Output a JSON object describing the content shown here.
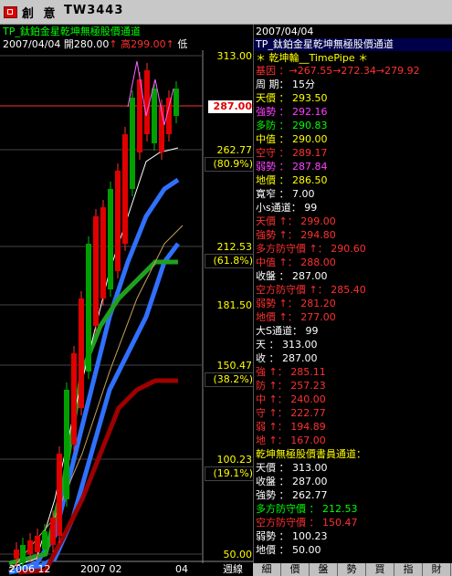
{
  "titlebar": {
    "title": "創  意",
    "code": "TW3443"
  },
  "chart_header": {
    "title": "TP_鈦鉑金星乾坤無極股價通道",
    "date": "2007/04/04",
    "open": "開280.00",
    "high": "高299.00",
    "last": "低"
  },
  "price_axis": [
    {
      "label": "313.00",
      "pct": ""
    },
    {
      "label": "287.00",
      "pct": "",
      "highlight": true
    },
    {
      "label": "262.77",
      "pct": "(80.9%)"
    },
    {
      "label": "212.53",
      "pct": "(61.8%)"
    },
    {
      "label": "181.50",
      "pct": ""
    },
    {
      "label": "150.47",
      "pct": "(38.2%)"
    },
    {
      "label": "100.23",
      "pct": "(19.1%)"
    },
    {
      "label": "50.00",
      "pct": ""
    }
  ],
  "time_axis": [
    "2006 12",
    "2007 02",
    "04",
    "週線"
  ],
  "panel": {
    "date": "2007/04/04",
    "title": "TP_鈦鉑金星乾坤無極股價通道",
    "rows": [
      {
        "text": "基因 ：→267.55→272.34→279.92",
        "color": "#ff3030"
      },
      {
        "text": "周   期：  15分",
        "color": "#ffffff"
      },
      {
        "text": "天價  ：  293.50",
        "color": "#ffff00"
      },
      {
        "text": "強勢  ：  292.16",
        "color": "#ff40ff"
      },
      {
        "text": "多防  ：  290.83",
        "color": "#00ff00"
      },
      {
        "text": "中值  ：  290.00",
        "color": "#ffff00"
      },
      {
        "text": "空守  ：  289.17",
        "color": "#ff3030"
      },
      {
        "text": "弱勢  ：  287.84",
        "color": "#ff40ff"
      },
      {
        "text": "地價  ：  286.50",
        "color": "#ffff00"
      },
      {
        "text": "寬窄  ：   7.00",
        "color": "#ffffff"
      },
      {
        "text": "小s通道：  99",
        "color": "#ffffff"
      },
      {
        "text": "天價  ↑：  299.00",
        "color": "#ff3030"
      },
      {
        "text": "強勢  ↑：  294.80",
        "color": "#ff3030"
      },
      {
        "text": "多方防守價 ↑： 290.60",
        "color": "#ff3030"
      },
      {
        "text": "中值  ↑：  288.00",
        "color": "#ff3030"
      },
      {
        "text": "收盤  ：  287.00",
        "color": "#ffffff"
      },
      {
        "text": "空方防守價 ↑：  285.40",
        "color": "#ff3030"
      },
      {
        "text": "弱勢  ↑：  281.20",
        "color": "#ff3030"
      },
      {
        "text": "地價  ↑：  277.00",
        "color": "#ff3030"
      },
      {
        "text": "大S通道：  99",
        "color": "#ffffff"
      },
      {
        "text": "天   ：  313.00",
        "color": "#ffffff"
      },
      {
        "text": "  收  ：  287.00",
        "color": "#ffffff"
      },
      {
        "text": "強  ↑：  285.11",
        "color": "#ff3030"
      },
      {
        "text": "防  ↑：  257.23",
        "color": "#ff3030"
      },
      {
        "text": "中  ↑：  240.00",
        "color": "#ff3030"
      },
      {
        "text": "守  ↑：  222.77",
        "color": "#ff3030"
      },
      {
        "text": "弱  ↑：  194.89",
        "color": "#ff3030"
      },
      {
        "text": "地  ↑：  167.00",
        "color": "#ff3030"
      },
      {
        "text": "乾坤無極股價書員通道：",
        "color": "#ffff00"
      },
      {
        "text": "天價  ：  313.00",
        "color": "#ffffff"
      },
      {
        "text": "收盤  ：  287.00",
        "color": "#ffffff"
      },
      {
        "text": "強勢  ：  262.77",
        "color": "#ffffff"
      },
      {
        "text": "多方防守價 ：  212.53",
        "color": "#00ff00"
      },
      {
        "text": "空方防守價 ：  150.47",
        "color": "#ff3030"
      },
      {
        "text": "弱勢  ：  100.23",
        "color": "#ffffff"
      },
      {
        "text": "地價  ：  50.00",
        "color": "#ffffff"
      }
    ]
  },
  "bottom_tabs": [
    "細",
    "價",
    "盤",
    "勢",
    "買",
    "指",
    "財"
  ],
  "colors": {
    "up": "#e00000",
    "down": "#00a000",
    "accent": "#ffff00"
  }
}
